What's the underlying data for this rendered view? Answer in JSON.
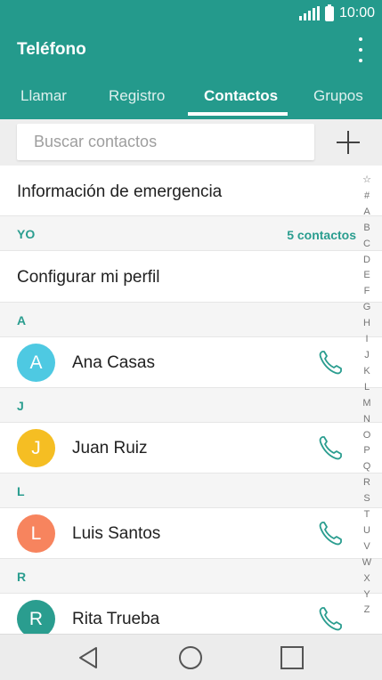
{
  "status_bar": {
    "time": "10:00",
    "icons": [
      "signal-icon",
      "battery-icon"
    ]
  },
  "app_bar": {
    "title": "Teléfono",
    "menu_icon": "more-vert-icon"
  },
  "tabs": [
    {
      "label": "Llamar",
      "active": false
    },
    {
      "label": "Registro",
      "active": false
    },
    {
      "label": "Contactos",
      "active": true
    },
    {
      "label": "Grupos",
      "active": false
    }
  ],
  "search": {
    "placeholder": "Buscar contactos",
    "value": "",
    "add_icon": "plus-icon"
  },
  "emergency": {
    "label": "Información de emergencia"
  },
  "me_section": {
    "header": "YO",
    "count": "5 contactos",
    "profile_label": "Configurar mi perfil"
  },
  "groups": [
    {
      "letter": "A",
      "contacts": [
        {
          "initial": "A",
          "name": "Ana Casas",
          "color": "#4ec9e2"
        }
      ]
    },
    {
      "letter": "J",
      "contacts": [
        {
          "initial": "J",
          "name": "Juan Ruiz",
          "color": "#f5be23"
        }
      ]
    },
    {
      "letter": "L",
      "contacts": [
        {
          "initial": "L",
          "name": "Luis Santos",
          "color": "#f7845e"
        }
      ]
    },
    {
      "letter": "R",
      "contacts": [
        {
          "initial": "R",
          "name": "Rita Trueba",
          "color": "#2a9d8f"
        }
      ]
    }
  ],
  "index_letters": [
    "☆",
    "#",
    "A",
    "B",
    "C",
    "D",
    "E",
    "F",
    "G",
    "H",
    "I",
    "J",
    "K",
    "L",
    "M",
    "N",
    "O",
    "P",
    "Q",
    "R",
    "S",
    "T",
    "U",
    "V",
    "W",
    "X",
    "Y",
    "Z"
  ],
  "nav_bar": {
    "buttons": [
      "back-icon",
      "home-icon",
      "recents-icon"
    ]
  },
  "colors": {
    "accent": "#249a8c",
    "call_icon": "#2a9d8f"
  }
}
